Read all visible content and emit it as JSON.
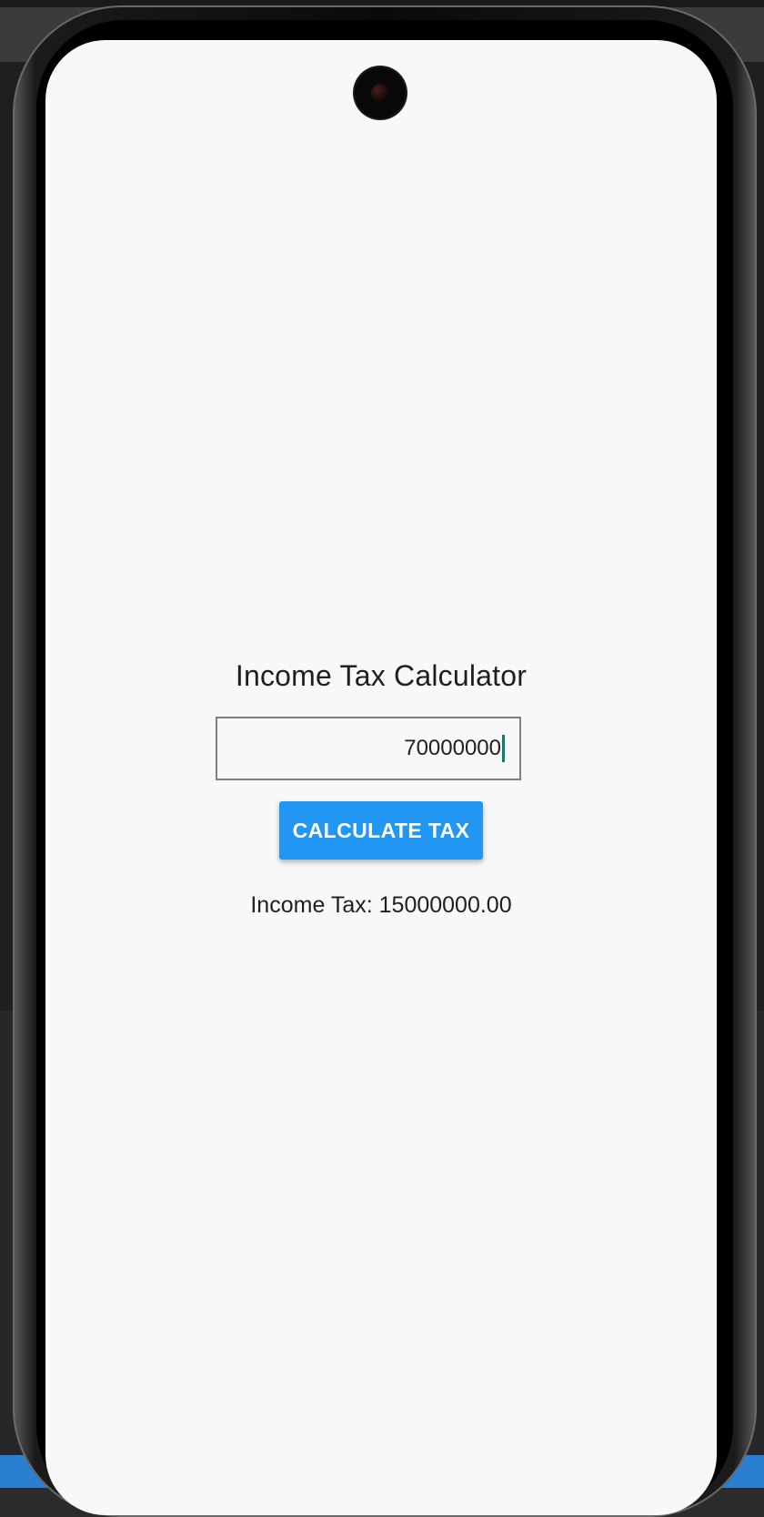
{
  "app": {
    "title": "Income Tax Calculator",
    "input": {
      "value": "70000000",
      "placeholder": ""
    },
    "button_label": "CALCULATE TAX",
    "result_text": "Income Tax: 15000000.00"
  },
  "colors": {
    "button": "#2196f3",
    "caret": "#0a7f70",
    "screen_background": "#f8f8f8"
  }
}
